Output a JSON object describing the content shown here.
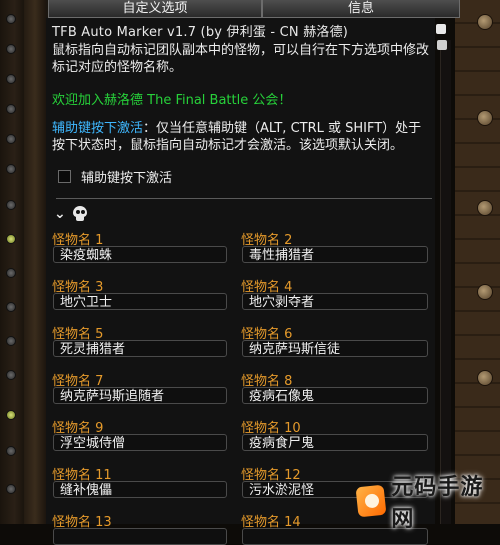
{
  "tabs": [
    {
      "label": "自定义选项",
      "active": true
    },
    {
      "label": "信息",
      "active": false
    }
  ],
  "addon": {
    "title": "TFB Auto Marker v1.7 (by 伊利蛋 - CN 赫洛德)",
    "description": "鼠标指向自动标记团队副本中的怪物，可以自行在下方选项中修改标记对应的怪物名称。",
    "welcome": "欢迎加入赫洛德 The Final Battle 公会！"
  },
  "modifier": {
    "heading": "辅助键按下激活",
    "text": "：仅当任意辅助键（ALT, CTRL 或 SHIFT）处于按下状态时，鼠标指向自动标记才会激活。该选项默认关闭。",
    "checkbox_label": "辅助键按下激活",
    "checked": false
  },
  "section": {
    "expanded": true,
    "icon": "skull-icon"
  },
  "monsters": [
    {
      "label": "怪物名 1",
      "value": "染疫蜘蛛"
    },
    {
      "label": "怪物名 2",
      "value": "毒性捕猎者"
    },
    {
      "label": "怪物名 3",
      "value": "地穴卫士"
    },
    {
      "label": "怪物名 4",
      "value": "地穴剥夺者"
    },
    {
      "label": "怪物名 5",
      "value": "死灵捕猎者"
    },
    {
      "label": "怪物名 6",
      "value": "纳克萨玛斯信徒"
    },
    {
      "label": "怪物名 7",
      "value": "纳克萨玛斯追随者"
    },
    {
      "label": "怪物名 8",
      "value": "疫病石像鬼"
    },
    {
      "label": "怪物名 9",
      "value": "浮空城侍僧"
    },
    {
      "label": "怪物名 10",
      "value": "疫病食尸鬼"
    },
    {
      "label": "怪物名 11",
      "value": "缝补傀儡"
    },
    {
      "label": "怪物名 12",
      "value": "污水淤泥怪"
    },
    {
      "label": "怪物名 13",
      "value": ""
    },
    {
      "label": "怪物名 14",
      "value": ""
    }
  ],
  "watermark": {
    "text": "元码手游网"
  },
  "colors": {
    "label_orange": "#e59a2b",
    "welcome_green": "#27d13a",
    "highlight_blue": "#3fb8ff"
  }
}
